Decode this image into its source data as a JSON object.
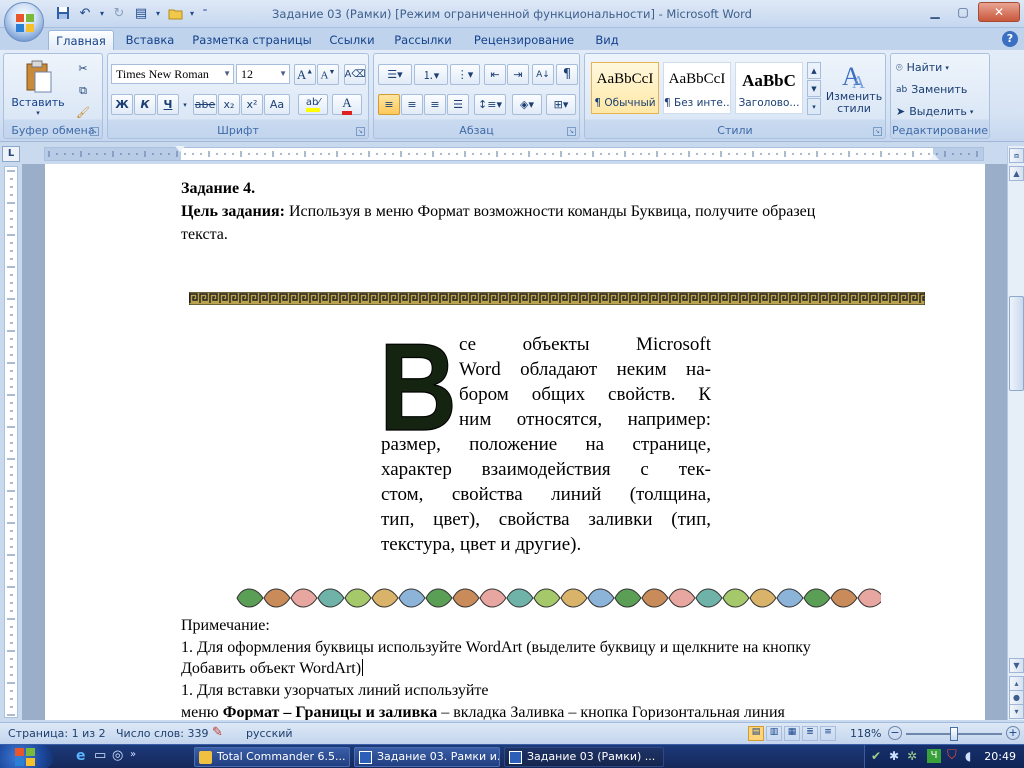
{
  "window": {
    "title": "Задание 03 (Рамки) [Режим ограниченной функциональности] - Microsoft Word"
  },
  "tabs": [
    {
      "label": "Главная",
      "active": true
    },
    {
      "label": "Вставка"
    },
    {
      "label": "Разметка страницы"
    },
    {
      "label": "Ссылки"
    },
    {
      "label": "Рассылки"
    },
    {
      "label": "Рецензирование"
    },
    {
      "label": "Вид"
    }
  ],
  "ribbon": {
    "clipboard": {
      "label": "Буфер обмена",
      "paste": "Вставить"
    },
    "font": {
      "label": "Шрифт",
      "font_name": "Times New Roman",
      "font_size": "12",
      "bold": "Ж",
      "italic": "К",
      "underline": "Ч",
      "strike": "abe",
      "subscript": "x₂",
      "superscript": "x²",
      "case": "Aa"
    },
    "paragraph": {
      "label": "Абзац"
    },
    "styles": {
      "label": "Стили",
      "items": [
        {
          "sample": "AaBbCcI",
          "name": "¶ Обычный",
          "selected": true
        },
        {
          "sample": "AaBbCcI",
          "name": "¶ Без инте..."
        },
        {
          "sample": "AaBbC",
          "name": "Заголово..."
        }
      ],
      "change": "Изменить стили"
    },
    "editing": {
      "label": "Редактирование",
      "find": "Найти",
      "replace": "Заменить",
      "select": "Выделить"
    }
  },
  "document": {
    "task_title": "Задание 4.",
    "goal_label": "Цель задания:",
    "goal_text": " Используя в меню  Формат возможности команды Буквица, получите образец",
    "goal_text2": "текста.",
    "dropcap": "В",
    "para_lines": [
      "се  объекты  Microsoft",
      "Word обладают неким на-",
      "бором  общих  свойств.  К",
      "ним относятся, например:",
      "размер, положение на странице,",
      "характер  взаимодействия  с  тек-",
      "стом, свойства линий (толщина,",
      "тип, цвет), свойства заливки (тип,",
      "текстура, цвет и другие)."
    ],
    "note_title": "Примечание:",
    "note1": "1. Для оформления буквицы используйте WordArt (выделите буквицу и щелкните на кнопку",
    "note1b": "Добавить объект WordArt)",
    "note2": "1. Для вставки узорчатых линий используйте",
    "note3_pre": "меню ",
    "note3_bold": "Формат – Границы и заливка",
    "note3_post": " – вкладка Заливка – кнопка Горизонтальная линия"
  },
  "status": {
    "page": "Страница: 1 из 2",
    "words": "Число слов: 339",
    "language": "русский",
    "zoom": "118%"
  },
  "taskbar": {
    "tasks": [
      {
        "label": "Total Commander 6.5..."
      },
      {
        "label": "Задание 03. Рамки и..."
      },
      {
        "label": "Задание 03 (Рамки) ...",
        "active": true
      }
    ],
    "clock": "20:49",
    "lang": "Ч"
  },
  "colors": {
    "accent": "#15428b",
    "ribbon_bg": "#dbe7f6",
    "taskbar": "#1c3a7a"
  }
}
